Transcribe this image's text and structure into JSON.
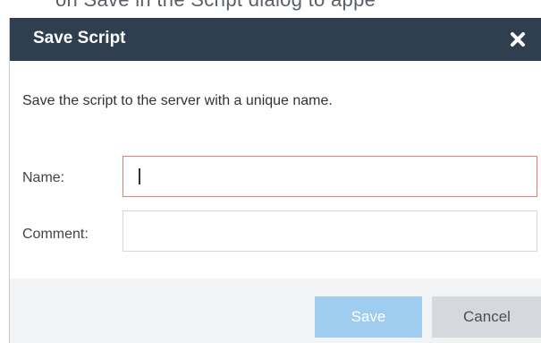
{
  "background_text": "on Save in the Script dialog to appe",
  "dialog": {
    "title": "Save Script",
    "description": "Save the script to the server with a unique name.",
    "fields": {
      "name_label": "Name:",
      "name_value": "",
      "comment_label": "Comment:",
      "comment_value": ""
    },
    "buttons": {
      "save_label": "Save",
      "cancel_label": "Cancel"
    }
  },
  "colors": {
    "header_bg": "#2f3f4f",
    "focus_border": "#e87a6e",
    "save_button_bg": "#9fcdf0",
    "cancel_button_bg": "#d5d9dd"
  },
  "icons": {
    "close": "close-icon"
  }
}
